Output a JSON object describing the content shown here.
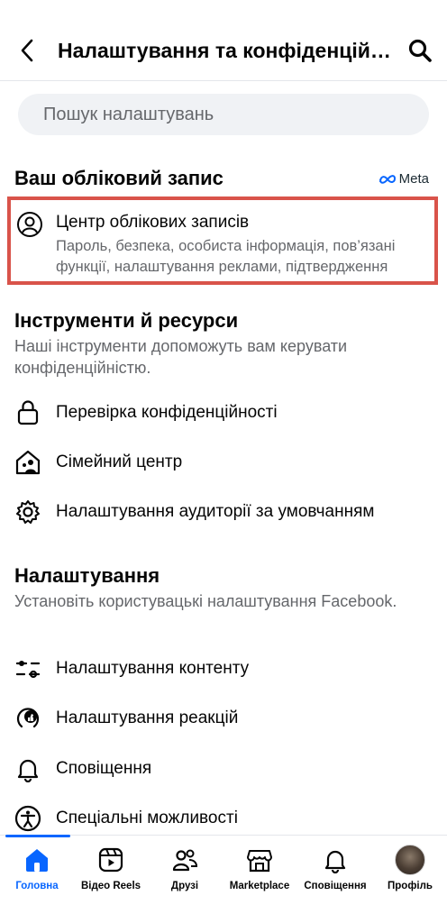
{
  "header": {
    "title": "Налаштування та конфіденційність",
    "back_icon": "chevron-left-icon",
    "search_icon": "search-icon"
  },
  "search": {
    "placeholder": "Пошук налаштувань",
    "value": ""
  },
  "account_section": {
    "title": "Ваш обліковий запис",
    "meta_label": "Meta",
    "card": {
      "icon": "person-circle-icon",
      "title": "Центр облікових записів",
      "description": "Пароль, безпека, особиста інформація, пов’язані функції, налаштування реклами, підтвердження",
      "highlight_color": "#d9534a"
    }
  },
  "tools_section": {
    "title": "Інструменти й ресурси",
    "subtitle": "Наші інструменти допоможуть вам керувати конфіденційністю.",
    "items": [
      {
        "icon": "lock-icon",
        "label": "Перевірка конфіденційності"
      },
      {
        "icon": "family-home-icon",
        "label": "Сімейний центр"
      },
      {
        "icon": "gear-icon",
        "label": "Налаштування аудиторії за умовчанням"
      }
    ]
  },
  "settings_section": {
    "title": "Налаштування",
    "subtitle": "Установіть користувацькі налаштування Facebook.",
    "items": [
      {
        "icon": "sliders-icon",
        "label": "Налаштування контенту"
      },
      {
        "icon": "reactions-icon",
        "label": "Налаштування реакцій"
      },
      {
        "icon": "bell-icon",
        "label": "Сповіщення"
      },
      {
        "icon": "accessibility-icon",
        "label": "Спеціальні можливості"
      }
    ]
  },
  "bottom_nav": {
    "accent_color": "#0866ff",
    "items": [
      {
        "icon": "home-icon",
        "label": "Головна",
        "active": true
      },
      {
        "icon": "video-reels-icon",
        "label": "Відео Reels",
        "active": false
      },
      {
        "icon": "friends-icon",
        "label": "Друзі",
        "active": false
      },
      {
        "icon": "marketplace-icon",
        "label": "Marketplace",
        "active": false
      },
      {
        "icon": "bell-icon",
        "label": "Сповіщення",
        "active": false
      },
      {
        "icon": "profile-avatar-icon",
        "label": "Профіль",
        "active": false
      }
    ]
  }
}
